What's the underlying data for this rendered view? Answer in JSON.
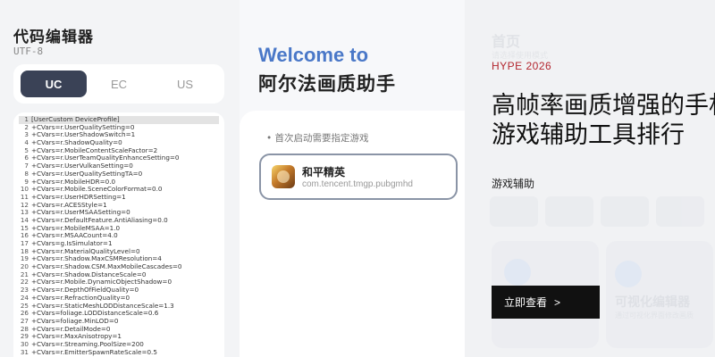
{
  "editor": {
    "title": "代码编辑器",
    "encoding": "UTF-8",
    "tabs": [
      {
        "label": "UC",
        "active": true
      },
      {
        "label": "EC",
        "active": false
      },
      {
        "label": "US",
        "active": false
      }
    ],
    "lines": [
      "[UserCustom DeviceProfile]",
      "+CVars=r.UserQualitySetting=0",
      "+CVars=r.UserShadowSwitch=1",
      "+CVars=r.ShadowQuality=0",
      "+CVars=r.MobileContentScaleFactor=2",
      "+CVars=r.UserTeamQualityEnhanceSetting=0",
      "+CVars=r.UserVulkanSetting=0",
      "+CVars=r.UserQualitySettingTA=0",
      "+CVars=r.MobileHDR=0.0",
      "+CVars=r.Mobile.SceneColorFormat=0.0",
      "+CVars=r.UserHDRSetting=1",
      "+CVars=r.ACESStyle=1",
      "+CVars=r.UserMSAASetting=0",
      "+CVars=r.DefaultFeature.AntiAliasing=0.0",
      "+CVars=r.MobileMSAA=1.0",
      "+CVars=r.MSAACount=4.0",
      "+CVars=g.IsSimulator=1",
      "+CVars=r.MaterialQualityLevel=0",
      "+CVars=r.Shadow.MaxCSMResolution=4",
      "+CVars=r.Shadow.CSM.MaxMobileCascades=0",
      "+CVars=r.Shadow.DistanceScale=0",
      "+CVars=r.Mobile.DynamicObjectShadow=0",
      "+CVars=r.DepthOfFieldQuality=0",
      "+CVars=r.RefractionQuality=0",
      "+CVars=r.StaticMeshLODDistanceScale=1.3",
      "+CVars=foliage.LODDistanceScale=0.6",
      "+CVars=foliage.MinLOD=0",
      "+CVars=r.DetailMode=0",
      "+CVars=r.MaxAnisotropy=1",
      "+CVars=r.Streaming.PoolSize=200",
      "+CVars=r.EmitterSpawnRateScale=0.5"
    ]
  },
  "welcome": {
    "title_en": "Welcome to",
    "title_cn": "阿尔法画质助手",
    "hint": "• 首次启动需要指定游戏",
    "game": {
      "name": "和平精英",
      "package": "com.tencent.tmgp.pubgmhd"
    }
  },
  "article": {
    "ghost_title": "首页",
    "ghost_subtitle": "请选择使用模式",
    "ghost_chips": [
      "",
      "",
      "",
      ""
    ],
    "ghost_feature": "可视化编辑器",
    "ghost_feature_sub": "通过可视化界面修改画质",
    "tag": "HYPE 2026",
    "headline": "高帧率画质增强的手机游戏辅助工具排行",
    "category": "游戏辅助",
    "cta_label": "立即查看",
    "cta_arrow": ">"
  },
  "colors": {
    "tab_active": "#3a4256",
    "welcome_accent": "#4a78c8",
    "tag_red": "#b3262f",
    "button_dark": "#111111"
  }
}
